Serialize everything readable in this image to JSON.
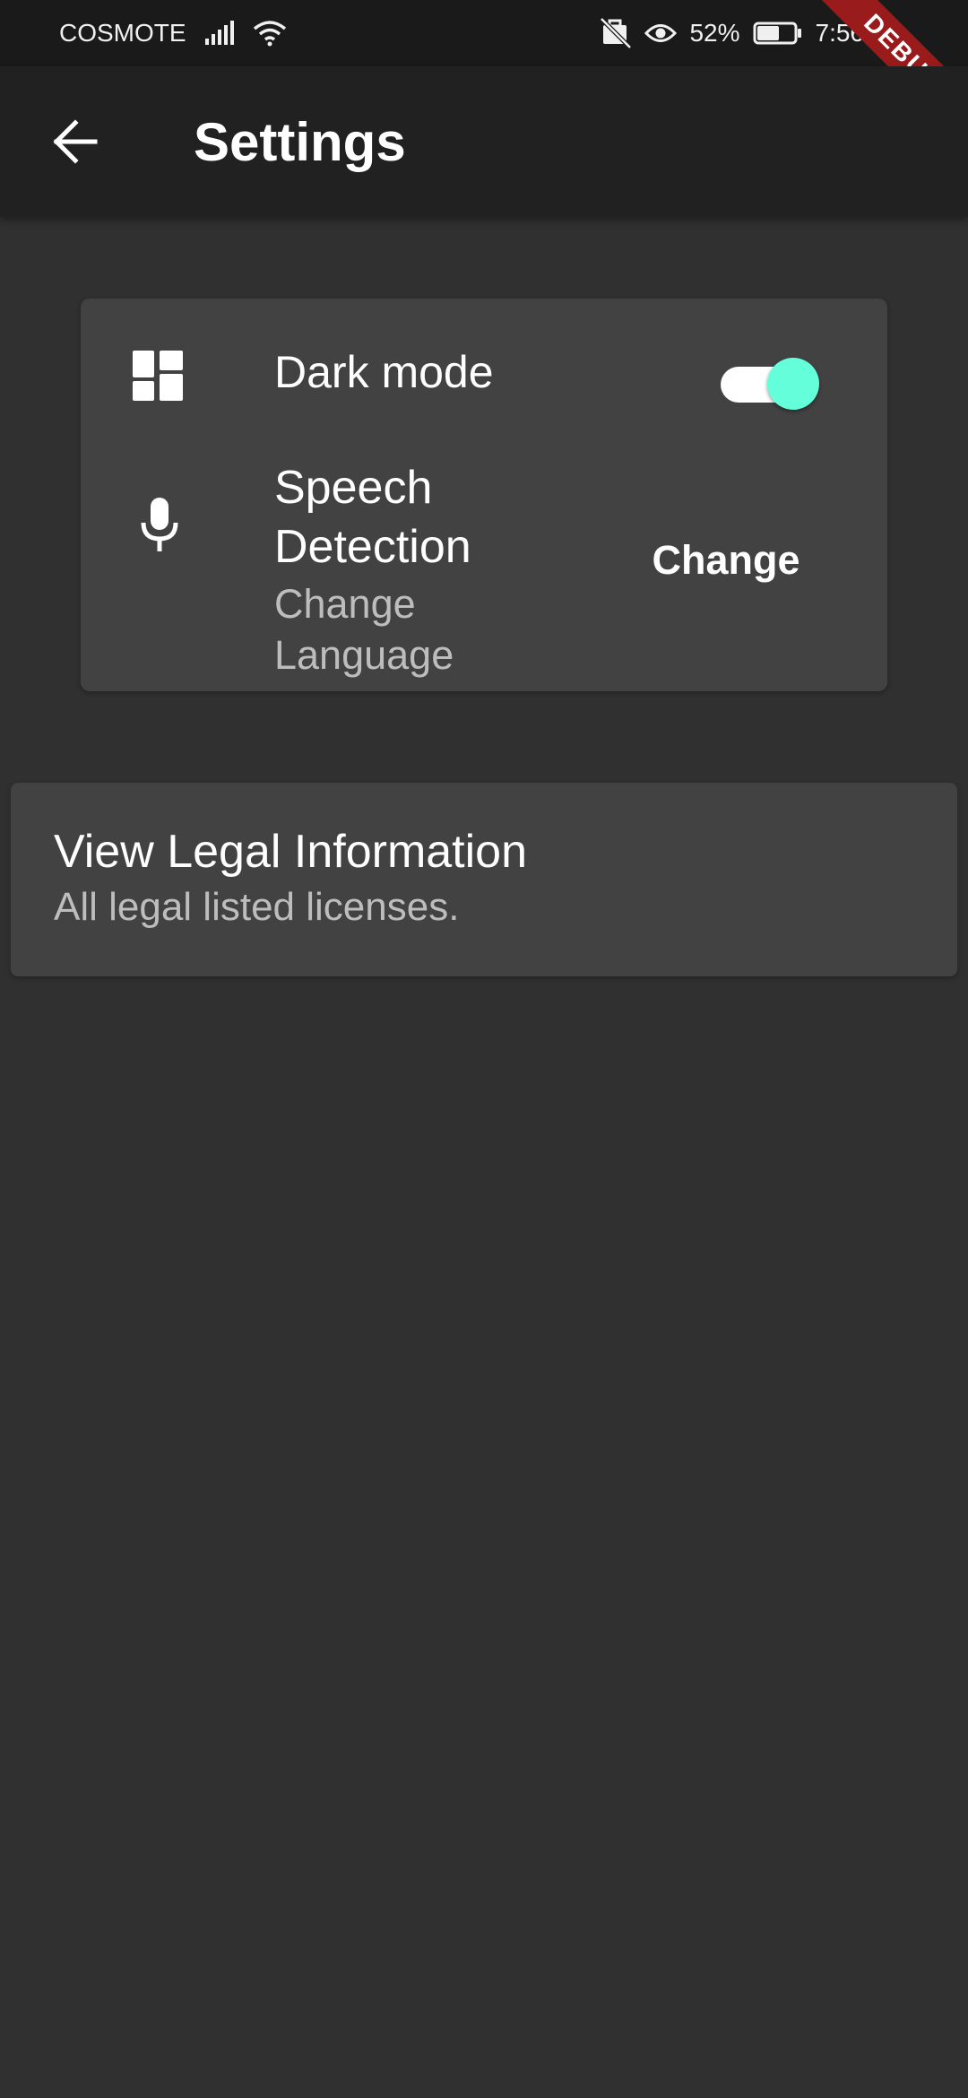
{
  "status_bar": {
    "carrier": "COSMOTE",
    "battery_percent": "52%",
    "time": "7:56",
    "icons": [
      "signal-icon",
      "wifi-icon",
      "no-sim-icon",
      "eye-icon",
      "battery-icon"
    ]
  },
  "debug_banner": "DEBUG",
  "app_bar": {
    "back_icon": "arrow-back-icon",
    "title": "Settings"
  },
  "settings_card": {
    "dark_mode": {
      "icon": "dashboard-icon",
      "label": "Dark mode",
      "enabled": true
    },
    "speech_detection": {
      "icon": "microphone-icon",
      "title": "Speech Detection",
      "subtitle": "Change Language",
      "button_label": "Change"
    }
  },
  "legal": {
    "title": "View Legal Information",
    "subtitle": "All legal listed licenses."
  },
  "colors": {
    "background": "#303030",
    "app_bar": "#212121",
    "card": "#424242",
    "accent": "#64ffda",
    "debug_ribbon": "#9a1b1b"
  }
}
